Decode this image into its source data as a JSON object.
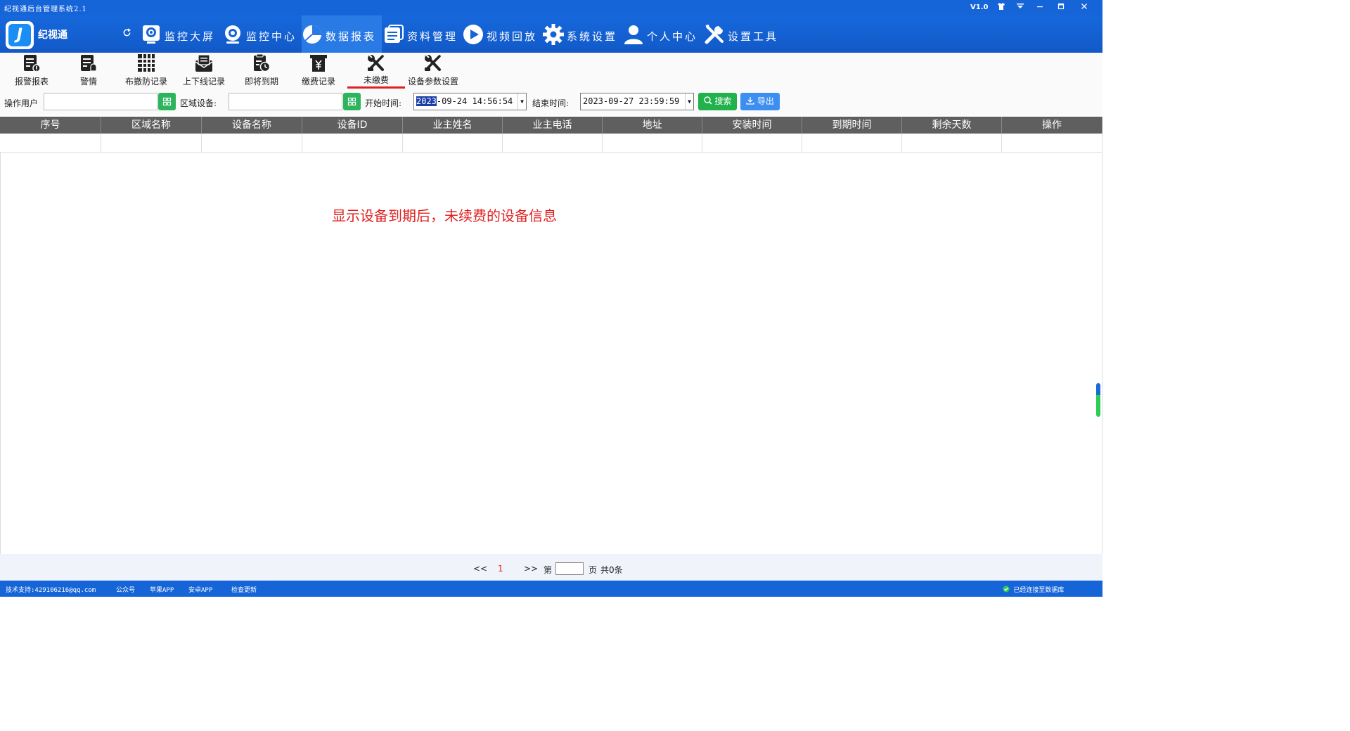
{
  "window": {
    "title": "纪视通后台管理系统2.1",
    "version": "V1.0"
  },
  "nav": {
    "brand": "纪视通",
    "items": [
      {
        "label": "监控大屏",
        "icon": "monitor-screen-icon"
      },
      {
        "label": "监控中心",
        "icon": "webcam-icon"
      },
      {
        "label": "数据报表",
        "icon": "pie-chart-icon"
      },
      {
        "label": "资料管理",
        "icon": "folder-list-icon"
      },
      {
        "label": "视频回放",
        "icon": "play-circle-icon"
      },
      {
        "label": "系统设置",
        "icon": "gear-icon"
      },
      {
        "label": "个人中心",
        "icon": "user-icon"
      },
      {
        "label": "设置工具",
        "icon": "wrench-screwdriver-icon"
      }
    ]
  },
  "subnav": {
    "items": [
      {
        "label": "报警报表",
        "icon": "alarm-report-icon"
      },
      {
        "label": "警情",
        "icon": "alert-doc-icon"
      },
      {
        "label": "布撤防记录",
        "icon": "arm-disarm-icon"
      },
      {
        "label": "上下线记录",
        "icon": "envelope-icon"
      },
      {
        "label": "即将到期",
        "icon": "clock-doc-icon"
      },
      {
        "label": "缴费记录",
        "icon": "payment-icon"
      },
      {
        "label": "未缴费",
        "icon": "tools-icon"
      },
      {
        "label": "设备参数设置",
        "icon": "device-settings-icon"
      }
    ]
  },
  "filter": {
    "user_label": "操作用户",
    "area_label": "区域设备:",
    "start_label": "开始时间:",
    "start_value_selected": "2023",
    "start_value_rest": "-09-24 14:56:54",
    "end_label": "结束时间:",
    "end_value": "2023-09-27 23:59:59",
    "search_label": "搜索",
    "export_label": "导出"
  },
  "table": {
    "columns": [
      "序号",
      "区域名称",
      "设备名称",
      "设备ID",
      "业主姓名",
      "业主电话",
      "地址",
      "安装时间",
      "到期时间",
      "剩余天数",
      "操作"
    ],
    "rows": []
  },
  "annotation": "显示设备到期后，未续费的设备信息",
  "pager": {
    "prev": "<<",
    "current": "1",
    "next": ">>",
    "page_prefix": "第",
    "page_suffix": "页",
    "total": "共0条"
  },
  "status": {
    "support": "技术支持:429106216@qq.com",
    "wechat": "公众号",
    "ios": "苹果APP",
    "android": "安卓APP",
    "update": "检查更新",
    "connection": "已经连接至数据库"
  },
  "colors": {
    "accent": "#1565d8",
    "highlight": "#e02020",
    "search_green": "#21b24c",
    "export_blue": "#3c8ef0"
  }
}
